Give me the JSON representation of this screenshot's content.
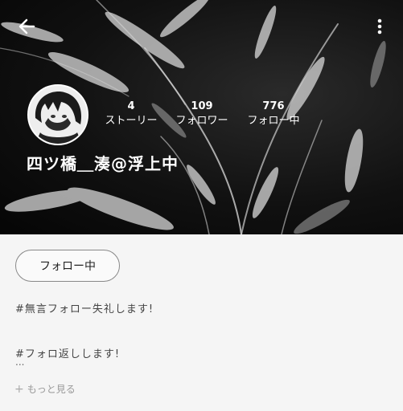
{
  "header": {
    "back_icon": "arrow-left-icon",
    "menu_icon": "more-vertical-icon"
  },
  "profile": {
    "username": "四ツ橋＿湊@浮上中",
    "stats": [
      {
        "value": "4",
        "label": "ストーリー"
      },
      {
        "value": "109",
        "label": "フォロワー"
      },
      {
        "value": "776",
        "label": "フォロー中"
      }
    ]
  },
  "actions": {
    "follow_label": "フォロー中"
  },
  "bio": {
    "text": "#無言フォロー失礼します!\n\n#フォロ返しします!",
    "ellipsis": "...",
    "more_label": "もっと見る"
  },
  "colors": {
    "hero_background": "#0a0a0a",
    "page_background": "#f5f5f5",
    "text_primary": "#ffffff",
    "button_border": "#888888"
  }
}
